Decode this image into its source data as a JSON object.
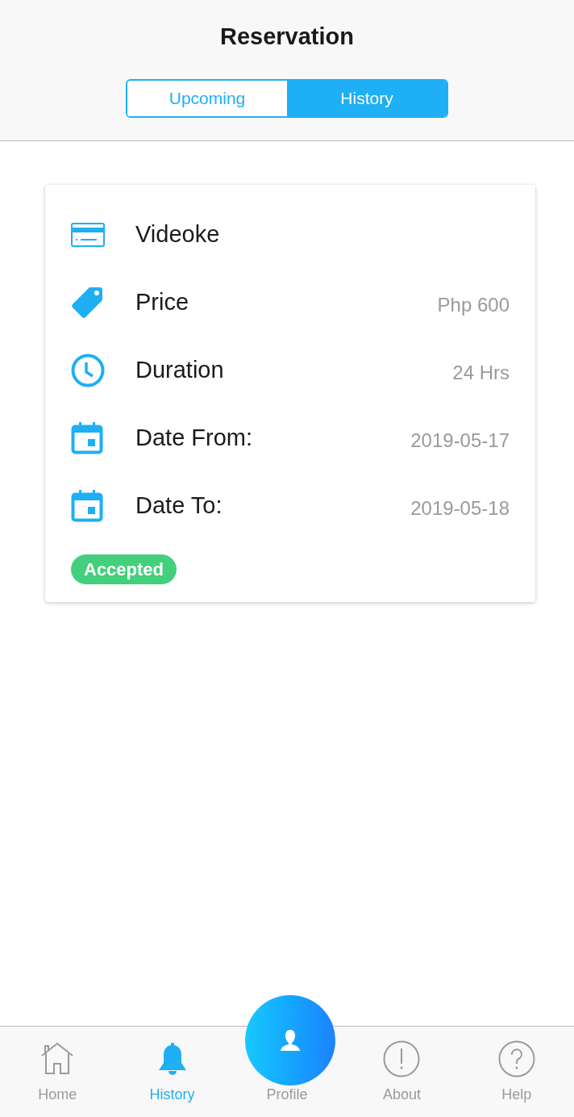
{
  "header": {
    "title": "Reservation"
  },
  "tabs": [
    {
      "label": "Upcoming",
      "selected": false
    },
    {
      "label": "History",
      "selected": true
    }
  ],
  "card": {
    "rows": [
      {
        "kind": "card",
        "label": "Videoke"
      },
      {
        "kind": "tag",
        "label": "Price",
        "value": "Php 600"
      },
      {
        "kind": "clock",
        "label": "Duration",
        "value": "24 Hrs"
      },
      {
        "kind": "calendar",
        "label": "Date From:",
        "value": "2019-05-17"
      },
      {
        "kind": "calendar",
        "label": "Date To:",
        "value": "2019-05-18"
      }
    ],
    "status": {
      "label": "Accepted",
      "color": "#43cf7c"
    }
  },
  "nav": [
    {
      "kind": "home",
      "label": "Home",
      "selected": false
    },
    {
      "kind": "bell",
      "label": "History",
      "selected": true
    },
    {
      "kind": "profile",
      "label": "Profile",
      "selected": false
    },
    {
      "kind": "about",
      "label": "About",
      "selected": false
    },
    {
      "kind": "help",
      "label": "Help",
      "selected": false
    }
  ]
}
